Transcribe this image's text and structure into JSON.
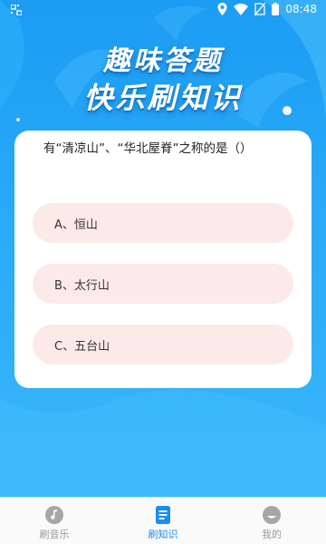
{
  "status_bar": {
    "time": "08:48",
    "icons": [
      "qr-icon",
      "location-icon",
      "wifi-icon",
      "no-sim-icon",
      "battery-icon"
    ]
  },
  "hero": {
    "line1": "趣味答题",
    "line2": "快乐刷知识"
  },
  "quiz": {
    "question": "有“清凉山”、“华北屋脊”之称的是（）",
    "options": [
      {
        "label": "A、恒山"
      },
      {
        "label": "B、太行山"
      },
      {
        "label": "C、五台山"
      }
    ]
  },
  "bottom_nav": {
    "items": [
      {
        "label": "刷音乐",
        "icon": "music-icon",
        "active": false
      },
      {
        "label": "刷知识",
        "icon": "book-icon",
        "active": true
      },
      {
        "label": "我的",
        "icon": "profile-icon",
        "active": false
      }
    ]
  },
  "colors": {
    "primary": "#1fa4f5",
    "active_nav": "#1a8df0",
    "inactive_nav": "#9a9a9a",
    "option_bg": "#fbeae8"
  }
}
